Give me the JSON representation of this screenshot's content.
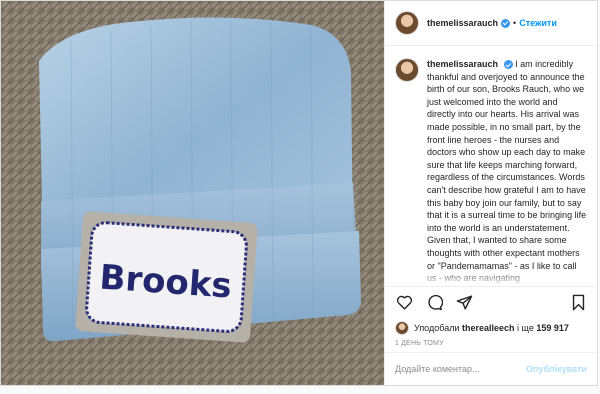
{
  "post": {
    "username": "themelissarauch",
    "follow_label": "Стежити",
    "caption_username": "themelissarauch",
    "caption": "I am incredibly thankful and overjoyed to announce the birth of our son, Brooks Rauch, who we just welcomed into the world and directly into our hearts. His arrival was made possible, in no small part, by the front line heroes - the nurses and doctors who show up each day to make sure that life keeps marching forward, regardless of the circumstances. Words can't describe how grateful I am to have this baby boy join our family, but to say that it is a surreal time to be bringing life into the world is an understatement. Given that, I wanted to share some thoughts with other expectant mothers or \"Pandemamamas\" - as I like to call us - who are navigating",
    "liked_prefix": "Уподобали",
    "liked_by": "therealleech",
    "liked_middle": "і ще",
    "liked_count": "159 917",
    "timestamp": "1 ДЕНЬ ТОМУ",
    "comment_placeholder": "Додайте коментар...",
    "publish_label": "Опублікувати",
    "hat_label": "Brooks"
  },
  "icons": {
    "like": "heart-icon",
    "comment": "comment-icon",
    "share": "share-icon",
    "save": "bookmark-icon"
  }
}
